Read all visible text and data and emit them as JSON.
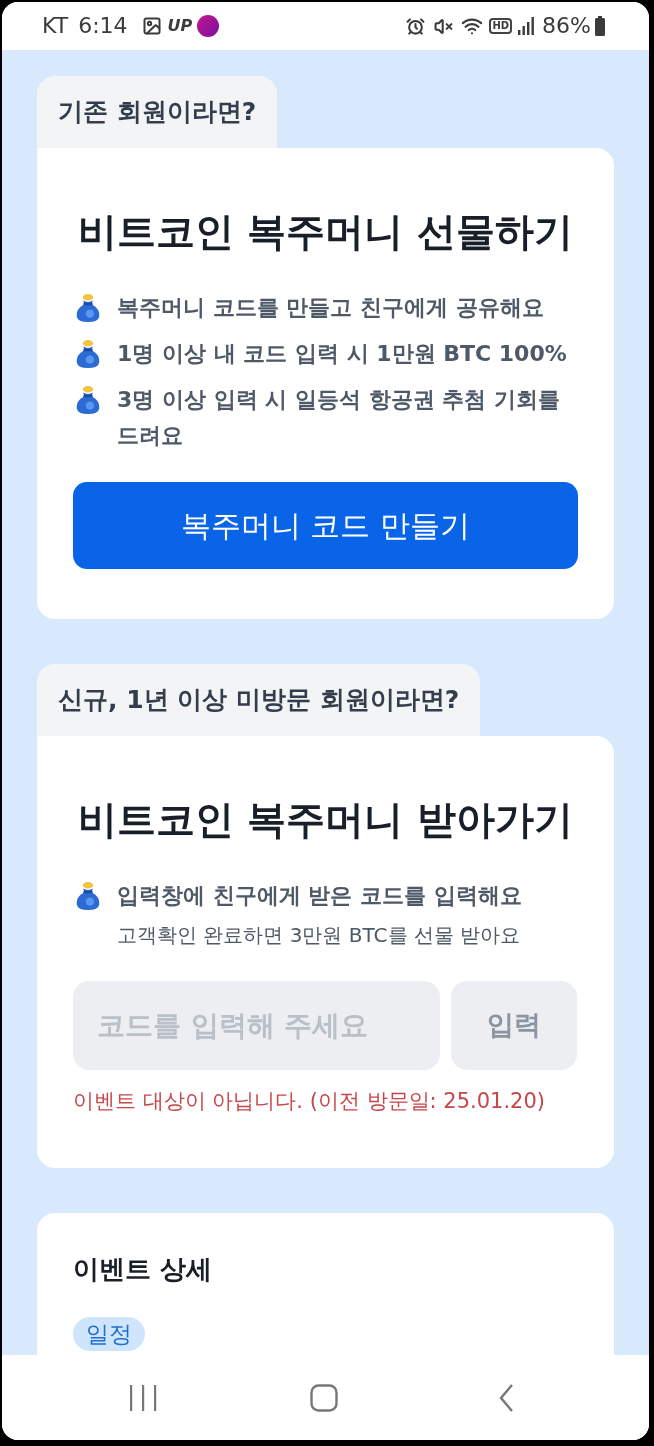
{
  "status_bar": {
    "carrier": "KT",
    "time": "6:14",
    "app_label": "UP",
    "hd_label": "HD",
    "battery": "86%"
  },
  "sections": [
    {
      "kind": "gift",
      "tab": "기존 회원이라면?",
      "title": "비트코인 복주머니 선물하기",
      "bullets": [
        {
          "text": "복주머니 코드를 만들고 친구에게 공유해요"
        },
        {
          "text": "1명 이상 내 코드 입력 시 1만원 BTC 100%"
        },
        {
          "text": "3명 이상 입력 시 일등석 항공권 추첨 기회를 드려요"
        }
      ],
      "button": "복주머니 코드 만들기"
    },
    {
      "kind": "receive",
      "tab": "신규, 1년 이상 미방문 회원이라면?",
      "title": "비트코인 복주머니 받아가기",
      "bullets": [
        {
          "text": "입력창에 친구에게 받은 코드를 입력해요",
          "note": "고객확인 완료하면 3만원 BTC를 선물 받아요"
        }
      ],
      "code_input": {
        "placeholder": "코드를 입력해 주세요"
      },
      "submit": {
        "label": "입력",
        "disabled": true
      },
      "error": "이벤트 대상이 아닙니다. (이전 방문일: 25.01.20)"
    }
  ],
  "event_detail": {
    "title": "이벤트 상세",
    "badge": "일정"
  }
}
